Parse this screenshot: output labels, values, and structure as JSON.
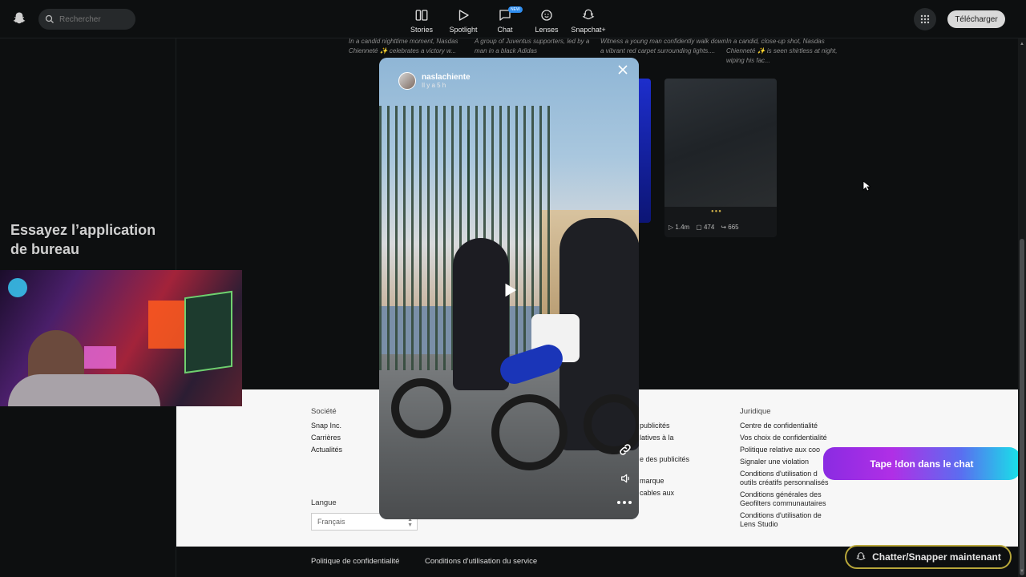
{
  "header": {
    "search_placeholder": "Rechercher",
    "nav": [
      {
        "label": "Stories",
        "icon": "stories-icon"
      },
      {
        "label": "Spotlight",
        "icon": "spotlight-play-icon"
      },
      {
        "label": "Chat",
        "icon": "chat-icon",
        "badge": "NEW"
      },
      {
        "label": "Lenses",
        "icon": "lenses-icon"
      },
      {
        "label": "Snapchat+",
        "icon": "snapchat-plus-icon"
      }
    ],
    "download_label": "Télécharger"
  },
  "sidebar": {
    "promo_title": "Essayez l’application de bureau"
  },
  "captions": [
    "In a candid nighttime moment, Nasdas Chienneté ✨ celebrates a victory w...",
    "A group of Juventus supporters, led by a man in a black Adidas",
    "Witness a young man confidently walk down a vibrant red carpet surrounding lights....",
    "In a candid, close-up shot, Nasdas Chienneté ✨ is seen shirtless at night, wiping his fac..."
  ],
  "card": {
    "views": "1.4m",
    "comments": "474",
    "shares": "665"
  },
  "modal": {
    "username": "naslachiente",
    "time_ago": "Il y a 5 h"
  },
  "footer": {
    "col1": {
      "heading": "Société",
      "links": [
        "Snap Inc.",
        "Carrières",
        "Actualités"
      ]
    },
    "col3": {
      "links": [
        "publicités",
        "latives à la",
        "e des publicités",
        "marque",
        "cables aux"
      ]
    },
    "col4": {
      "heading": "Juridique",
      "links": [
        "Centre de confidentialité",
        "Vos choix de confidentialité",
        "Politique relative aux coo",
        "Signaler une violation",
        "Conditions d'utilisation d",
        "outils créatifs personnalisés",
        "Conditions générales des",
        "Geofilters communautaires",
        "Conditions d'utilisation de",
        "Lens Studio"
      ]
    },
    "language_label": "Langue",
    "language_value": "Français",
    "bottom_links": [
      "Politique de confidentialité",
      "Conditions d'utilisation du service"
    ]
  },
  "overlays": {
    "chat_promo": "Tape !don dans le chat",
    "chat_now": "Chatter/Snapper maintenant"
  }
}
